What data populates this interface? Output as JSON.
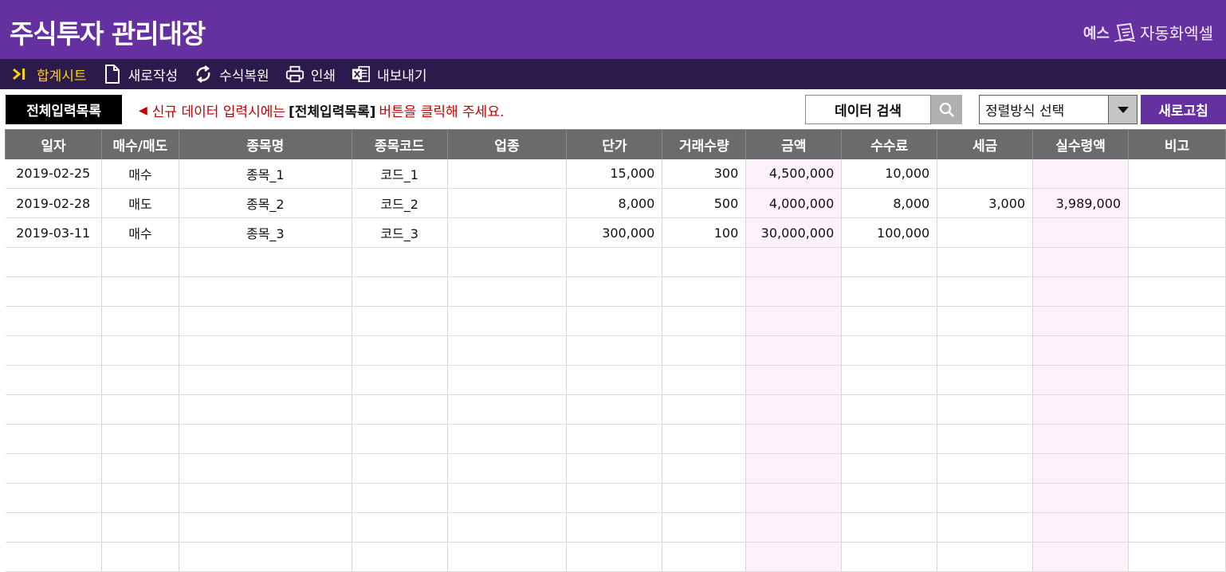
{
  "app": {
    "title": "주식투자 관리대장",
    "brand_prefix": "예스",
    "brand_name": "자동화엑셀"
  },
  "toolbar": {
    "items": [
      {
        "label": "합계시트",
        "icon": "skip-to-end-icon",
        "active": true
      },
      {
        "label": "새로작성",
        "icon": "new-document-icon"
      },
      {
        "label": "수식복원",
        "icon": "restore-icon"
      },
      {
        "label": "인쇄",
        "icon": "printer-icon"
      },
      {
        "label": "내보내기",
        "icon": "excel-export-icon"
      }
    ]
  },
  "actions": {
    "list_button": "전체입력목록",
    "notice_prefix": "신규 데이터 입력시에는",
    "notice_emphasis": "[전체입력목록]",
    "notice_suffix": "버튼을 클릭해 주세요.",
    "search_label": "데이터 검색",
    "sort_placeholder": "정렬방식 선택",
    "refresh_button": "새로고침"
  },
  "colors": {
    "header": "#6530a0",
    "toolbar": "#2c1a4c",
    "active_tool": "#ffd400",
    "notice": "#c00000",
    "table_header": "#6b6b6b",
    "highlight_column": "#fdf1fb"
  },
  "table": {
    "columns": [
      "일자",
      "매수/매도",
      "종목명",
      "종목코드",
      "업종",
      "단가",
      "거래수량",
      "금액",
      "수수료",
      "세금",
      "실수령액",
      "비고"
    ],
    "rows": [
      [
        "2019-02-25",
        "매수",
        "종목_1",
        "코드_1",
        "",
        "15,000",
        "300",
        "4,500,000",
        "10,000",
        "",
        "",
        ""
      ],
      [
        "2019-02-28",
        "매도",
        "종목_2",
        "코드_2",
        "",
        "8,000",
        "500",
        "4,000,000",
        "8,000",
        "3,000",
        "3,989,000",
        ""
      ],
      [
        "2019-03-11",
        "매수",
        "종목_3",
        "코드_3",
        "",
        "300,000",
        "100",
        "30,000,000",
        "100,000",
        "",
        "",
        ""
      ],
      [
        "",
        "",
        "",
        "",
        "",
        "",
        "",
        "",
        "",
        "",
        "",
        ""
      ],
      [
        "",
        "",
        "",
        "",
        "",
        "",
        "",
        "",
        "",
        "",
        "",
        ""
      ],
      [
        "",
        "",
        "",
        "",
        "",
        "",
        "",
        "",
        "",
        "",
        "",
        ""
      ],
      [
        "",
        "",
        "",
        "",
        "",
        "",
        "",
        "",
        "",
        "",
        "",
        ""
      ],
      [
        "",
        "",
        "",
        "",
        "",
        "",
        "",
        "",
        "",
        "",
        "",
        ""
      ],
      [
        "",
        "",
        "",
        "",
        "",
        "",
        "",
        "",
        "",
        "",
        "",
        ""
      ],
      [
        "",
        "",
        "",
        "",
        "",
        "",
        "",
        "",
        "",
        "",
        "",
        ""
      ],
      [
        "",
        "",
        "",
        "",
        "",
        "",
        "",
        "",
        "",
        "",
        "",
        ""
      ],
      [
        "",
        "",
        "",
        "",
        "",
        "",
        "",
        "",
        "",
        "",
        "",
        ""
      ],
      [
        "",
        "",
        "",
        "",
        "",
        "",
        "",
        "",
        "",
        "",
        "",
        ""
      ],
      [
        "",
        "",
        "",
        "",
        "",
        "",
        "",
        "",
        "",
        "",
        "",
        ""
      ]
    ]
  }
}
